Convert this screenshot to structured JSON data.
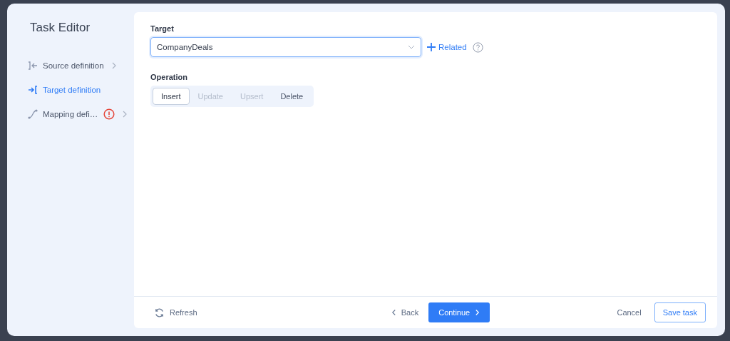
{
  "window": {
    "title": "Task Editor"
  },
  "sidebar": {
    "items": [
      {
        "kind": "source",
        "label": "Source definition",
        "selected": false,
        "warning": false,
        "expandable": true
      },
      {
        "kind": "target",
        "label": "Target definition",
        "selected": true,
        "warning": false,
        "expandable": false
      },
      {
        "kind": "mapping",
        "label": "Mapping defi…",
        "selected": false,
        "warning": true,
        "expandable": true
      }
    ]
  },
  "target": {
    "label": "Target",
    "value": "CompanyDeals",
    "related_link": "Related"
  },
  "operation": {
    "label": "Operation",
    "options": [
      {
        "label": "Insert",
        "selected": true,
        "disabled": false
      },
      {
        "label": "Update",
        "selected": false,
        "disabled": true
      },
      {
        "label": "Upsert",
        "selected": false,
        "disabled": true
      },
      {
        "label": "Delete",
        "selected": false,
        "disabled": false
      }
    ]
  },
  "footer": {
    "refresh": "Refresh",
    "back": "Back",
    "continue": "Continue",
    "cancel": "Cancel",
    "save": "Save task"
  }
}
